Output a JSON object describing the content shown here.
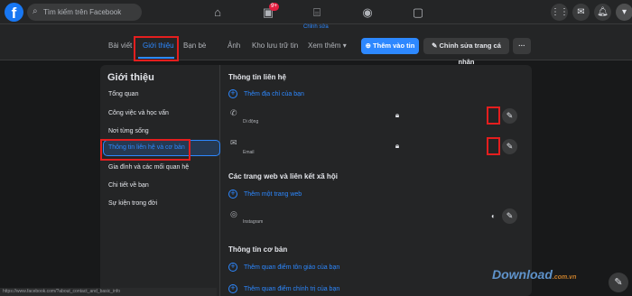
{
  "topbar": {
    "logo": "f",
    "search_placeholder": "Tìm kiếm trên Facebook",
    "notif_count": "9+"
  },
  "profile_header": {
    "edit_link": "Chỉnh sửa",
    "tabs": [
      "Bài viết",
      "Giới thiệu",
      "Bạn bè",
      "Ảnh",
      "Kho lưu trữ tin",
      "Xem thêm"
    ],
    "add_story": "Thêm vào tin",
    "edit_profile": "Chỉnh sửa trang cá nhân",
    "more": "···"
  },
  "about": {
    "title": "Giới thiệu",
    "nav": [
      "Tổng quan",
      "Công việc và học vấn",
      "Nơi từng sống",
      "Thông tin liên hệ và cơ bản",
      "Gia đình và các mối quan hệ",
      "Chi tiết về bạn",
      "Sự kiện trong đời"
    ],
    "contact_title": "Thông tin liên hệ",
    "add_address": "Thêm địa chỉ của bạn",
    "mobile_label": "Di động",
    "email_label": "Email",
    "web_title": "Các trang web và liên kết xã hội",
    "add_website": "Thêm một trang web",
    "instagram_label": "Instagram",
    "basic_title": "Thông tin cơ bản",
    "add_religion": "Thêm quan điểm tôn giáo của bạn",
    "add_politics": "Thêm quan điểm chính trị của bạn"
  },
  "status_url": "https://www.facebook.com/?about_contact_and_basic_info",
  "watermark": "Download",
  "watermark_suffix": ".com.vn",
  "icons": {
    "home": "home-icon",
    "watch": "watch-icon",
    "marketplace": "marketplace-icon",
    "groups": "groups-icon",
    "gaming": "gaming-icon",
    "menu": "menu-icon",
    "messenger": "messenger-icon",
    "bell": "bell-icon",
    "account": "account-icon"
  },
  "colors": {
    "accent": "#2d88ff",
    "bg": "#18191a",
    "surface": "#242526",
    "highlight": "#e41e1e"
  }
}
